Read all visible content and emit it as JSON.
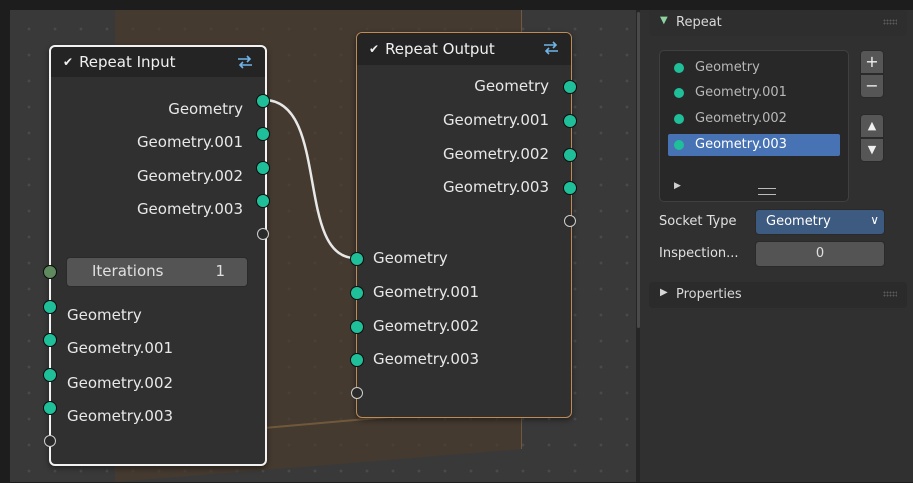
{
  "repeat_input": {
    "title": "Repeat Input",
    "outputs": [
      "Geometry",
      "Geometry.001",
      "Geometry.002",
      "Geometry.003"
    ],
    "iterations_label": "Iterations",
    "iterations_value": "1",
    "inputs": [
      "Geometry",
      "Geometry.001",
      "Geometry.002",
      "Geometry.003"
    ]
  },
  "repeat_output": {
    "title": "Repeat Output",
    "outputs": [
      "Geometry",
      "Geometry.001",
      "Geometry.002",
      "Geometry.003"
    ],
    "inputs": [
      "Geometry",
      "Geometry.001",
      "Geometry.002",
      "Geometry.003"
    ]
  },
  "sidebar": {
    "repeat_panel_title": "Repeat",
    "items": [
      "Geometry",
      "Geometry.001",
      "Geometry.002",
      "Geometry.003"
    ],
    "selected_index": 3,
    "socket_type_label": "Socket Type",
    "socket_type_value": "Geometry",
    "inspection_label": "Inspection...",
    "inspection_value": "0",
    "properties_title": "Properties"
  },
  "colors": {
    "geometry_socket": "#1fbf9a",
    "selection": "#4772b3",
    "frame_zone": "#4a3b2c"
  },
  "icons": {
    "repeat_zone": "repeat-zone-icon",
    "add": "plus-icon",
    "remove": "minus-icon",
    "move_up": "chevron-up-icon",
    "move_down": "chevron-down-icon"
  }
}
